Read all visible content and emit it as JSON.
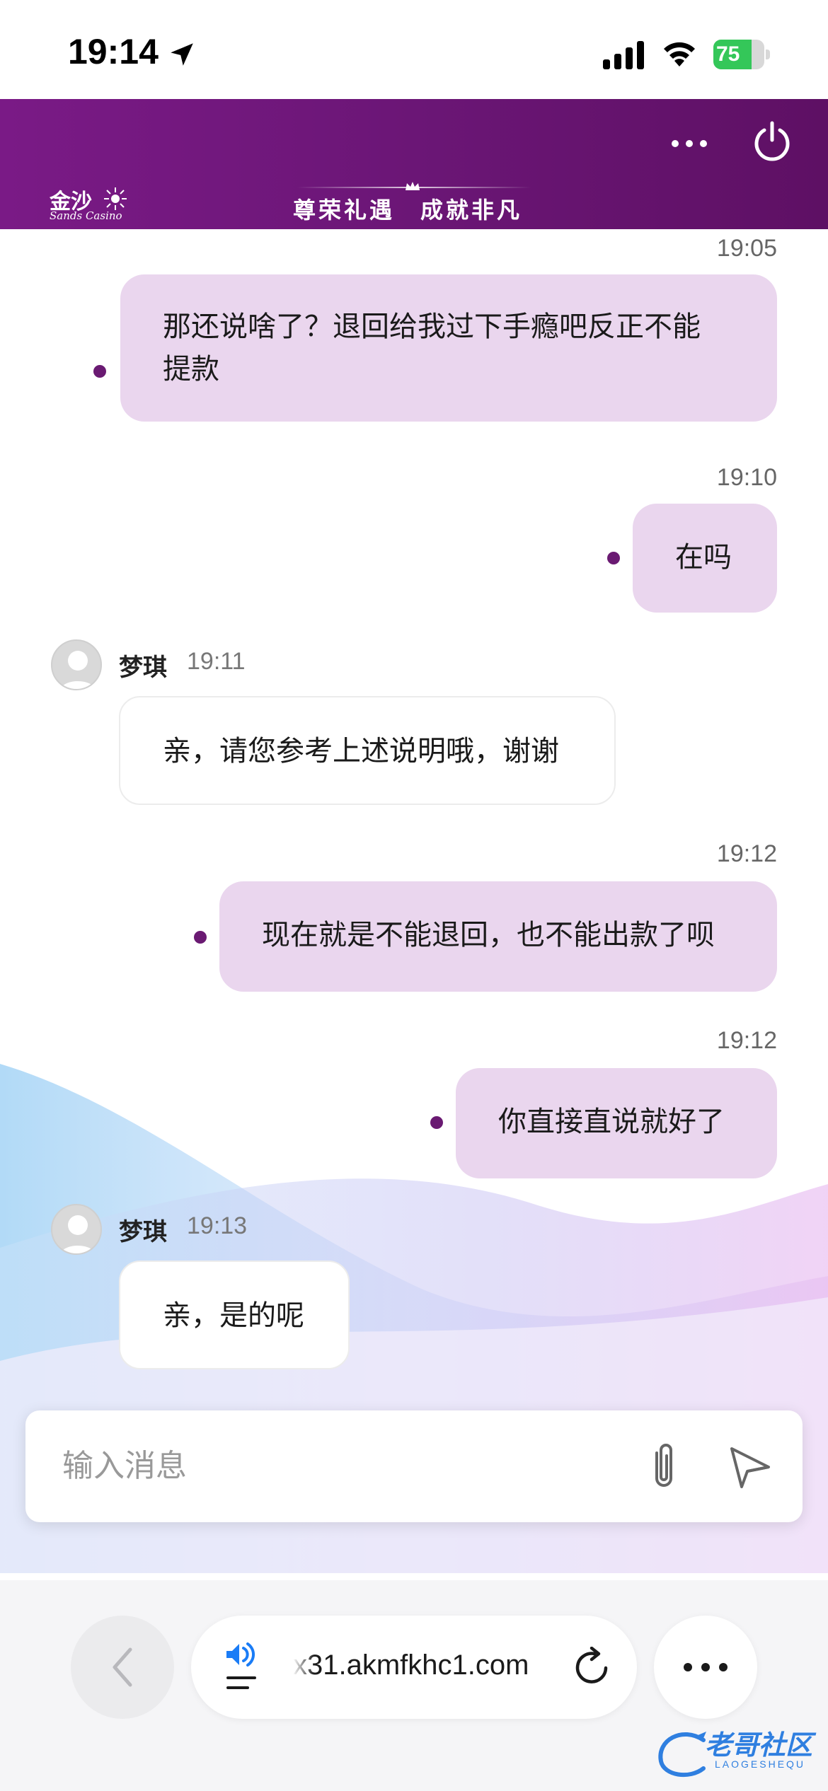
{
  "status_bar": {
    "time": "19:14",
    "battery": "75",
    "battery_level": 0.75
  },
  "header": {
    "logo_cn": "金沙",
    "logo_en": "Sands Casino",
    "slogan_left": "尊荣礼遇",
    "slogan_right": "成就非凡"
  },
  "messages": [
    {
      "direction": "out",
      "time": "19:05",
      "text_line1": "那还说啥了？退回给我过下手瘾吧反正不能",
      "text_line2": "提款"
    },
    {
      "direction": "out",
      "time": "19:10",
      "text": "在吗"
    },
    {
      "direction": "in",
      "sender": "梦琪",
      "time": "19:11",
      "text": "亲，请您参考上述说明哦，谢谢"
    },
    {
      "direction": "out",
      "time": "19:12",
      "text": "现在就是不能退回，也不能出款了呗"
    },
    {
      "direction": "out",
      "time": "19:12",
      "text": "你直接直说就好了"
    },
    {
      "direction": "in",
      "sender": "梦琪",
      "time": "19:13",
      "text": "亲，是的呢"
    }
  ],
  "composer": {
    "placeholder": "输入消息"
  },
  "browser": {
    "url": "x31.akmfkhc1.com"
  },
  "watermark": {
    "cn": "老哥社区",
    "en": "LAOGESHEQU"
  },
  "colors": {
    "header_purple": "#6b1676",
    "out_bubble": "#ead6ee",
    "dot": "#6a1a72",
    "battery_green": "#34c759"
  },
  "icons": [
    "location-arrow-icon",
    "signal-icon",
    "wifi-icon",
    "more-icon",
    "power-icon",
    "paperclip-icon",
    "send-icon",
    "chevron-left-icon",
    "audio-icon",
    "reload-icon",
    "ellipsis-icon"
  ]
}
